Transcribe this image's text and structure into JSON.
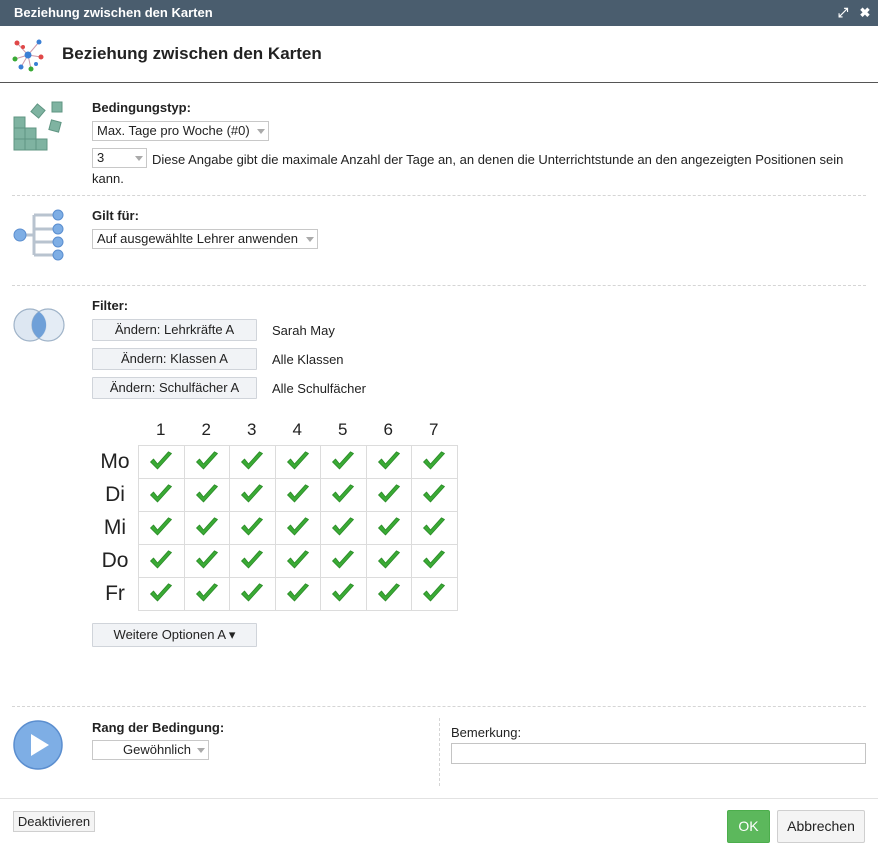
{
  "window": {
    "title": "Beziehung zwischen den Karten",
    "maximize_icon": "expand-arrows-icon",
    "close_icon": "close-icon"
  },
  "header": {
    "title": "Beziehung zwischen den Karten",
    "logo_icon": "network-nodes-icon"
  },
  "condition": {
    "label": "Bedingungstyp:",
    "type_value": "Max. Tage pro Woche (#0)",
    "number_value": "3",
    "description_line1": "Diese Angabe gibt die maximale Anzahl der Tage an, an denen die Unterrichtstunde an den angezeigten Positionen sein",
    "description_line2": "kann."
  },
  "applies": {
    "label": "Gilt für:",
    "value": "Auf ausgewählte Lehrer anwenden"
  },
  "filter": {
    "label": "Filter:",
    "rows": [
      {
        "button": "Ändern: Lehrkräfte A",
        "value": "Sarah May"
      },
      {
        "button": "Ändern: Klassen A",
        "value": "Alle Klassen"
      },
      {
        "button": "Ändern: Schulfächer A",
        "value": "Alle Schulfächer"
      }
    ]
  },
  "grid": {
    "columns": [
      "1",
      "2",
      "3",
      "4",
      "5",
      "6",
      "7"
    ],
    "rows": [
      "Mo",
      "Di",
      "Mi",
      "Do",
      "Fr"
    ],
    "checked": [
      [
        true,
        true,
        true,
        true,
        true,
        true,
        true
      ],
      [
        true,
        true,
        true,
        true,
        true,
        true,
        true
      ],
      [
        true,
        true,
        true,
        true,
        true,
        true,
        true
      ],
      [
        true,
        true,
        true,
        true,
        true,
        true,
        true
      ],
      [
        true,
        true,
        true,
        true,
        true,
        true,
        true
      ]
    ],
    "check_color": "#3aaa35"
  },
  "more_options": "Weitere Optionen A ▾",
  "rank": {
    "label": "Rang der Bedingung:",
    "value": "Gewöhnlich"
  },
  "remark": {
    "label": "Bemerkung:",
    "value": ""
  },
  "footer": {
    "deactivate": "Deaktivieren",
    "ok": "OK",
    "cancel": "Abbrechen"
  },
  "colors": {
    "titlebar": "#4a5d6e",
    "ok_button": "#5cb85c",
    "icon_teal": "#7fb3a1",
    "icon_blue": "#6fa0d8"
  }
}
